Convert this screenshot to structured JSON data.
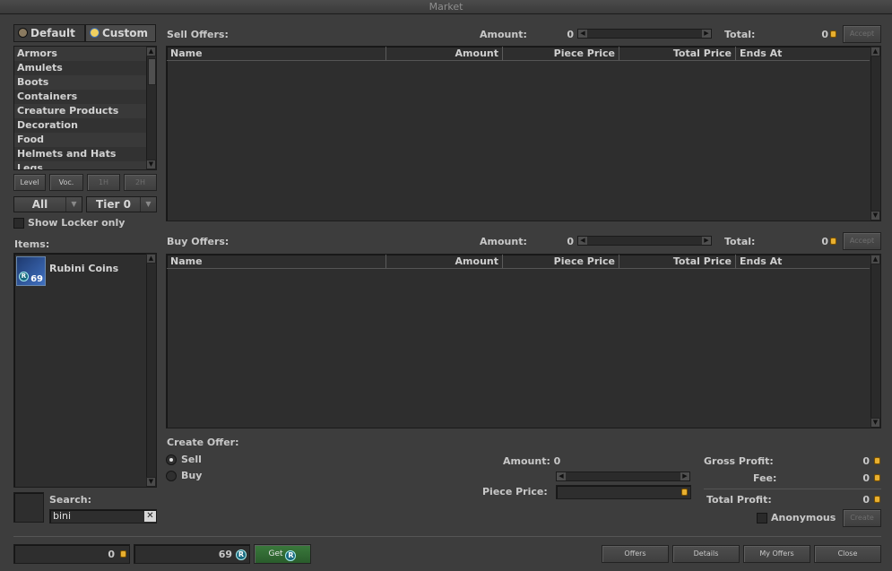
{
  "window": {
    "title": "Market"
  },
  "tabs": {
    "default": "Default",
    "custom": "Custom"
  },
  "categories": [
    "Armors",
    "Amulets",
    "Boots",
    "Containers",
    "Creature Products",
    "Decoration",
    "Food",
    "Helmets and Hats",
    "Legs"
  ],
  "filters": {
    "level": "Level",
    "voc": "Voc.",
    "one_hand": "1H",
    "two_hand": "2H",
    "class_select": "All",
    "tier_select": "Tier 0",
    "show_locker_label": "Show Locker only"
  },
  "items": {
    "label": "Items:",
    "list": [
      {
        "name": "Rubini Coins",
        "count": "69",
        "icon": "rubini-coin-icon"
      }
    ]
  },
  "search": {
    "label": "Search:",
    "value": "bini",
    "clear": "✕"
  },
  "sell_offers": {
    "label": "Sell Offers:",
    "amount_label": "Amount:",
    "amount_value": "0",
    "total_label": "Total:",
    "total_value": "0",
    "accept": "Accept"
  },
  "buy_offers": {
    "label": "Buy Offers:",
    "amount_label": "Amount:",
    "amount_value": "0",
    "total_label": "Total:",
    "total_value": "0",
    "accept": "Accept"
  },
  "table_columns": [
    "Name",
    "Amount",
    "Piece Price",
    "Total Price",
    "Ends At"
  ],
  "create_offer": {
    "label": "Create Offer:",
    "sell": "Sell",
    "buy": "Buy",
    "amount_label": "Amount: 0",
    "piece_price_label": "Piece Price:",
    "gross_profit_label": "Gross Profit:",
    "gross_profit_value": "0",
    "fee_label": "Fee:",
    "fee_value": "0",
    "total_profit_label": "Total Profit:",
    "total_profit_value": "0",
    "anonymous_label": "Anonymous",
    "create": "Create"
  },
  "footer": {
    "gold_balance": "0",
    "coin_balance": "69",
    "get": "Get",
    "offers": "Offers",
    "details": "Details",
    "my_offers": "My Offers",
    "close": "Close"
  },
  "colors": {
    "background": "#3d3d3d",
    "panel": "#2e2e2e",
    "get_button": "#2e6a30",
    "gold": "#e8b030"
  }
}
